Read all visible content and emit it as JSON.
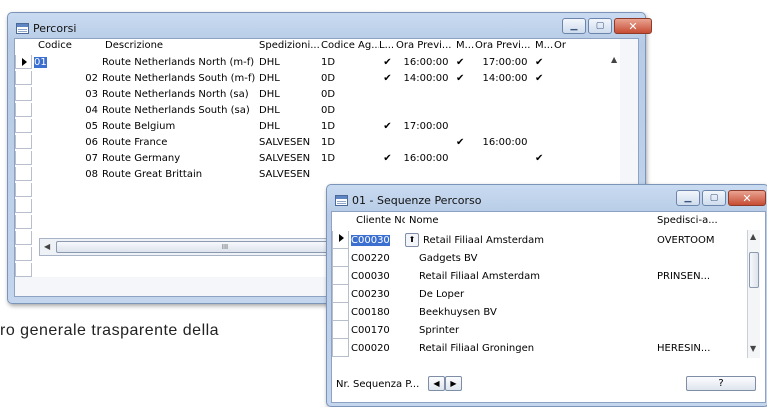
{
  "background": {
    "text": "ro generale trasparente della"
  },
  "window1": {
    "title": "Percorsi",
    "columns": [
      "Codice",
      "Descrizione",
      "Spedizioni...",
      "Codice Ag...",
      "L...",
      "Ora Previ...",
      "M...",
      "Ora Previ...",
      "M...",
      "Or"
    ],
    "rows": [
      {
        "codice": "01",
        "descr": "Route Netherlands North (m-f)",
        "sped": "DHL",
        "agente": "1D",
        "l": "✔",
        "ora1": "16:00:00",
        "m1": "✔",
        "ora2": "17:00:00",
        "m2": "✔"
      },
      {
        "codice": "02",
        "descr": "Route Netherlands South (m-f)",
        "sped": "DHL",
        "agente": "0D",
        "l": "✔",
        "ora1": "14:00:00",
        "m1": "✔",
        "ora2": "14:00:00",
        "m2": "✔"
      },
      {
        "codice": "03",
        "descr": "Route Netherlands North (sa)",
        "sped": "DHL",
        "agente": "0D",
        "l": "",
        "ora1": "",
        "m1": "",
        "ora2": "",
        "m2": ""
      },
      {
        "codice": "04",
        "descr": "Route Netherlands South (sa)",
        "sped": "DHL",
        "agente": "0D",
        "l": "",
        "ora1": "",
        "m1": "",
        "ora2": "",
        "m2": ""
      },
      {
        "codice": "05",
        "descr": "Route Belgium",
        "sped": "DHL",
        "agente": "1D",
        "l": "✔",
        "ora1": "17:00:00",
        "m1": "",
        "ora2": "",
        "m2": ""
      },
      {
        "codice": "06",
        "descr": "Route France",
        "sped": "SALVESEN",
        "agente": "1D",
        "l": "",
        "ora1": "",
        "m1": "✔",
        "ora2": "16:00:00",
        "m2": ""
      },
      {
        "codice": "07",
        "descr": "Route Germany",
        "sped": "SALVESEN",
        "agente": "1D",
        "l": "✔",
        "ora1": "16:00:00",
        "m1": "",
        "ora2": "",
        "m2": "✔"
      },
      {
        "codice": "08",
        "descr": "Route Great Brittain",
        "sped": "SALVESEN",
        "agente": "",
        "l": "",
        "ora1": "",
        "m1": "",
        "ora2": "",
        "m2": ""
      }
    ],
    "scroll_thumb": "III"
  },
  "window2": {
    "title": "01 - Sequenze Percorso",
    "columns": [
      "Cliente No.",
      "Nome",
      "Spedisci-a..."
    ],
    "rows": [
      {
        "cliente": "C00030",
        "nome": "Retail Filiaal Amsterdam",
        "sped": "OVERTOOM"
      },
      {
        "cliente": "C00220",
        "nome": "Gadgets BV",
        "sped": ""
      },
      {
        "cliente": "C00030",
        "nome": "Retail Filiaal Amsterdam",
        "sped": "PRINSEN..."
      },
      {
        "cliente": "C00230",
        "nome": "De Loper",
        "sped": ""
      },
      {
        "cliente": "C00180",
        "nome": "Beekhuysen BV",
        "sped": ""
      },
      {
        "cliente": "C00170",
        "nome": "Sprinter",
        "sped": ""
      },
      {
        "cliente": "C00020",
        "nome": "Retail Filiaal Groningen",
        "sped": "HERESIN..."
      }
    ],
    "footer_label": "Nr. Sequenza P...",
    "help_button": "?"
  }
}
